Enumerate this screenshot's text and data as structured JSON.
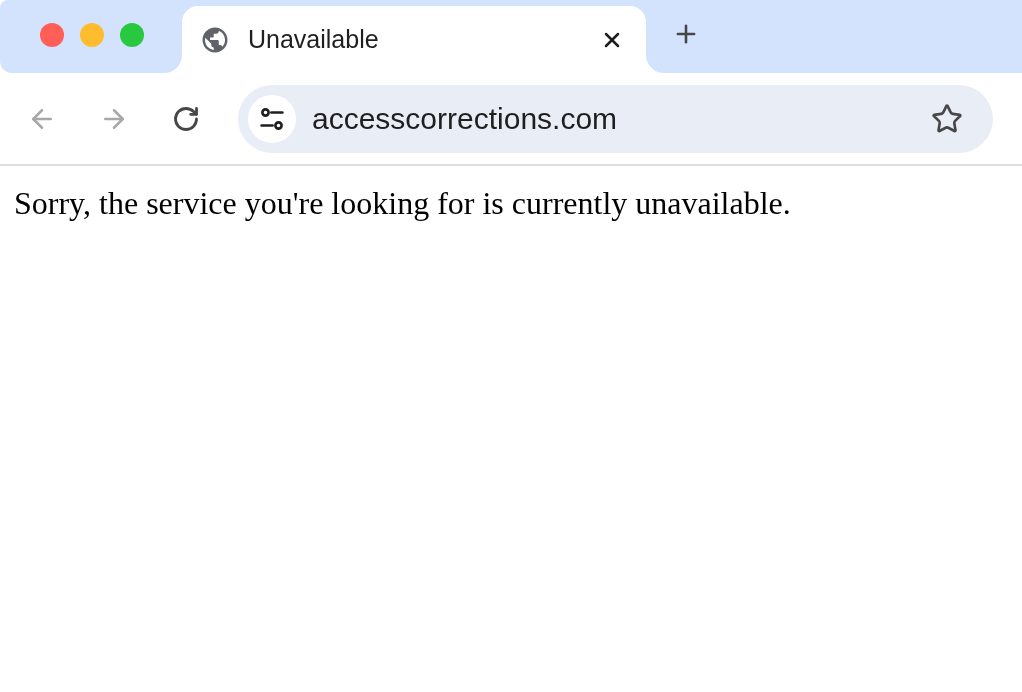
{
  "window": {
    "controls": [
      {
        "color": "#ff5f57"
      },
      {
        "color": "#febc2e"
      },
      {
        "color": "#28c840"
      }
    ]
  },
  "tabs": [
    {
      "title": "Unavailable",
      "selected": true
    }
  ],
  "toolbar": {
    "back": {
      "disabled": true
    },
    "forward": {
      "disabled": true
    }
  },
  "address_bar": {
    "url": "accesscorrections.com",
    "bookmarked": false
  },
  "page": {
    "message": "Sorry, the service you're looking for is currently unavailable."
  }
}
